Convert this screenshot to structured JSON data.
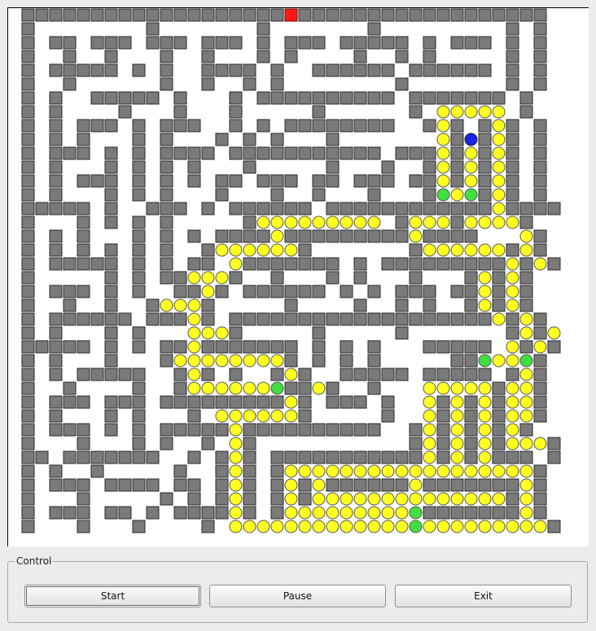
{
  "control": {
    "group_title": "Control",
    "start_label": "Start",
    "pause_label": "Pause",
    "exit_label": "Exit"
  },
  "colors": {
    "wall": "#7a7a7a",
    "open": "#ffffff",
    "path": "#ffff22",
    "branch": "#3fe03f",
    "current": "#1a24e6",
    "entrance": "#ff1a1a"
  },
  "maze": {
    "legend": {
      "#": "wall",
      ".": "open",
      "o": "path",
      "g": "branch",
      "b": "current",
      "R": "entrance"
    },
    "rows": [
      "###################R##################",
      "#........#.......#.......#.........#.#",
      "#.##.###.###.###.#.###.#####.#.###.#.#",
      "#..#..#...#..#...#.#....#..#.#.....#.#",
      "#.#####.#.#..####.#..######.######.#.#",
      "#..#......#..#..#.#........#.......#.#",
      "#.#..#####.#...#.##########.#######.#.",
      "#.#....#...#...#.....#......#.ooooo.#.",
      "#.#.###.#.###..#.#.########..#o#.#o#.#",
      "#.#.#...#.#...#.#.#...#.......o#b#o#.#",
      "#.###.#.#.####.###########.###o#o#o#.#",
      "#.#...#.#.#.#...#.....#...#..#o#o#o#.#",
      "#.#.###.#.#.#.##.###.##.###.##o#o#o#.#",
      "#.#...#.#.#...#...#..#...#...#gog#o#.#",
      "#####.#..###.#.######.############o####",
      "#...#.#.#.#.....#ooooooooo.#ooo#oooo#",
      "#.#.#...#.#.#.####o#########o####...o#",
      "#.#.#.#.#.#..#oooooo#.......#oooooo#o#",
      "#.#####.#.#.##.o#######.#.#########o#o#",
      "#.....#.#.##ooo#..#...#.#...#...#o#o#",
      "#.###.#.#..##o#.######.#.#.###.##o#o#",
      "#..#..#..#ooo#.....#....#..#.#..#o#o#",
      "#.######.###o#.###################o#o#",
      "#.#...#.#...ooo#.....#.....#.......#o#o#",
      "#####.#.#.##o#######.#.#.#...#####.o#o#",
      "#.#...#...#oooooooo#.#.#.#.....##goog#",
      "#.#.#####..#o#.#..#o#..#####.#####.#o#",
      "#..#....#..#oooooog##o#..#...ooooo#oo#",
      "#.###.###.#########o#.###.#..o#o#o#oo#",
      "#.#...#.#...#.oooooo#.....#..o#o#o#oo#",
      "#.###.#.#.#####o##########..#o#o#o#o#",
      "#...#...#.#..#.o#...........#o#o#o#ooo#",
      "##.#######..#.#o#.###########o#o#o###.#",
      "#.#..#.....#..#o#.#oooooooooooooooooo#",
      "#.###.####.##.#o#.#o#o######o#######o#",
      "#...#.....#.#.#o#.#o#oooooooooooooo#o#",
      "#.###.##.#.####o#.#ooooooooog#######o#",
      "#...#...#....#.ooooooooooooogooooooooo#",
      "######################################"
    ]
  }
}
